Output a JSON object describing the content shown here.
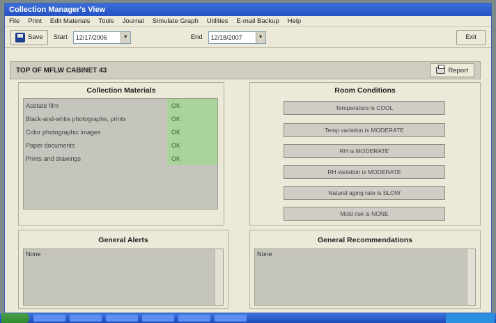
{
  "window": {
    "title": "Collection Manager's View"
  },
  "menu": [
    "File",
    "Print",
    "Edit Materials",
    "Tools",
    "Journal",
    "Simulate Graph",
    "Utilities",
    "E-mail Backup",
    "Help"
  ],
  "toolbar": {
    "save_label": "Save",
    "start_label": "Start",
    "start_value": "12/17/2006",
    "end_label": "End",
    "end_value": "12/18/2007",
    "exit_label": "Exit"
  },
  "location": {
    "title": "TOP OF MFLW CABINET 43",
    "report_label": "Report"
  },
  "materials": {
    "title": "Collection Materials",
    "items": [
      {
        "name": "Acetate film",
        "status": "OK"
      },
      {
        "name": "Black-and-white photographs, prints",
        "status": "OK"
      },
      {
        "name": "Color photographic images",
        "status": "OK"
      },
      {
        "name": "Paper documents",
        "status": "OK"
      },
      {
        "name": "Prints and drawings",
        "status": "OK"
      }
    ]
  },
  "conditions": {
    "title": "Room Conditions",
    "items": [
      "Temperature is COOL",
      "Temp variation is MODERATE",
      "RH is MODERATE",
      "RH variation is MODERATE",
      "Natural aging rate is SLOW",
      "Mold risk is NONE"
    ]
  },
  "alerts": {
    "title": "General Alerts",
    "text": "None"
  },
  "recommendations": {
    "title": "General Recommendations",
    "text": "None"
  },
  "colors": {
    "status_ok_bg": "#a9d59a",
    "titlebar": "#2551c4"
  }
}
